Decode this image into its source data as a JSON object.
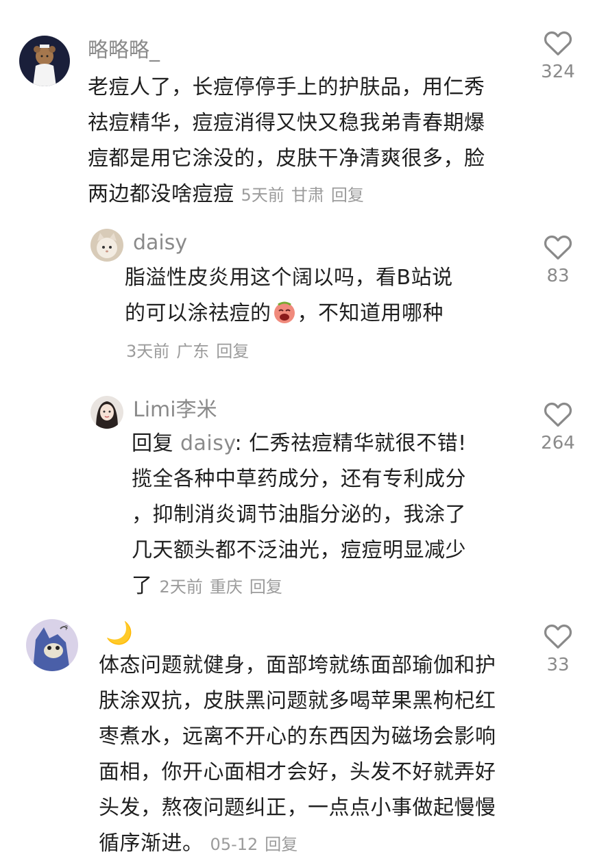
{
  "comments": [
    {
      "username": "略略略_",
      "lines": [
        "老痘人了，长痘停停手上的护肤品，用仁秀",
        "祛痘精华，痘痘消得又快又稳我弟青春期爆",
        "痘都是用它涂没的，皮肤干净清爽很多，脸",
        "两边都没啥痘痘"
      ],
      "time": "5天前",
      "location": "甘肃",
      "reply_label": "回复",
      "likes": "324"
    },
    {
      "username": "daisy",
      "line1": "脂溢性皮炎用这个阔以吗，看B站说",
      "line2_before": "的可以涂祛痘的",
      "line2_after": "，不知道用哪种",
      "emoji": "crying-face-emoji",
      "time": "3天前",
      "location": "广东",
      "reply_label": "回复",
      "likes": "83"
    },
    {
      "username": "Limi李米",
      "reply_prefix": "回复",
      "reply_target": "daisy",
      "first_line_rest": ": 仁秀祛痘精华就很不错!",
      "lines": [
        "揽全各种中草药成分，还有专利成分",
        "，抑制消炎调节油脂分泌的，我涂了",
        "几天额头都不泛油光，痘痘明显减少",
        "了"
      ],
      "time": "2天前",
      "location": "重庆",
      "reply_label": "回复",
      "likes": "264"
    },
    {
      "username": "🌙",
      "lines": [
        "体态问题就健身，面部垮就练面部瑜伽和护",
        "肤涂双抗，皮肤黑问题就多喝苹果黑枸杞红",
        "枣煮水，远离不开心的东西因为磁场会影响",
        "面相，你开心面相才会好，头发不好就弄好",
        "头发，熬夜问题纠正，一点点小事做起慢慢",
        "循序渐进。"
      ],
      "time": "05-12",
      "reply_label": "回复",
      "likes": "33"
    }
  ],
  "colors": {
    "text": "#1f1f1f",
    "meta": "#9b9b9b",
    "username": "#8a8a8a",
    "icon": "#8a8a8a"
  }
}
